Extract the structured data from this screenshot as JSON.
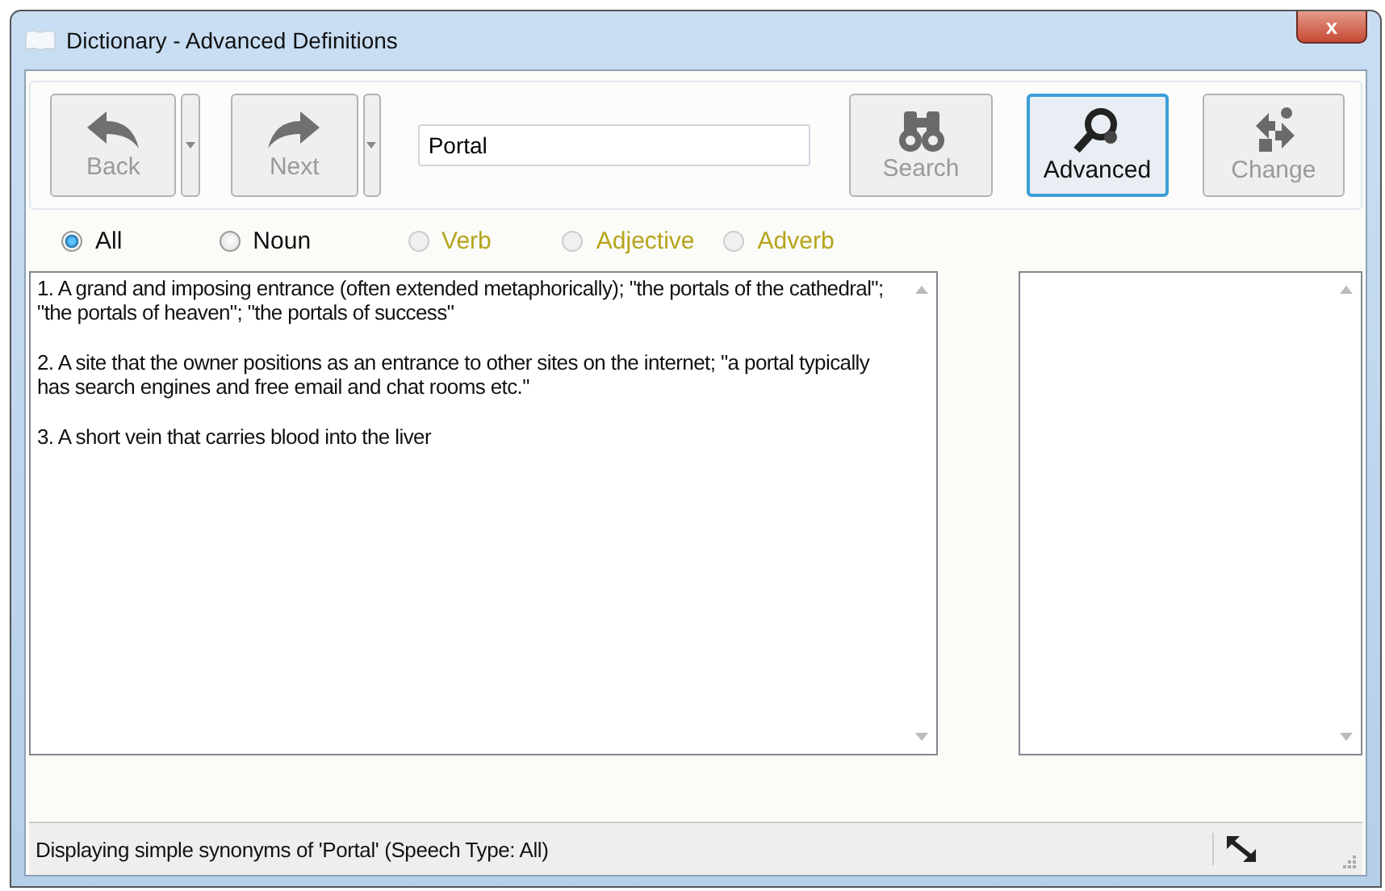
{
  "window": {
    "title": "Dictionary - Advanced Definitions",
    "close": "x"
  },
  "toolbar": {
    "nav_buttons": [
      {
        "label": "Back",
        "kind": "back",
        "disabled": true
      },
      {
        "label": "Next",
        "kind": "next",
        "disabled": true
      }
    ],
    "search": {
      "value": "Portal"
    },
    "action_buttons": [
      {
        "label": "Search",
        "kind": "search",
        "disabled": true,
        "selected": false
      },
      {
        "label": "Advanced",
        "kind": "advanced",
        "disabled": false,
        "selected": true
      },
      {
        "label": "Change",
        "kind": "change",
        "disabled": true,
        "selected": false
      }
    ]
  },
  "speech_types": [
    {
      "label": "All",
      "selected": true,
      "disabled": false
    },
    {
      "label": "Noun",
      "selected": false,
      "disabled": false
    },
    {
      "label": "Verb",
      "selected": false,
      "disabled": true
    },
    {
      "label": "Adjective",
      "selected": false,
      "disabled": true
    },
    {
      "label": "Adverb",
      "selected": false,
      "disabled": true
    }
  ],
  "definitions": [
    "1. A grand and imposing entrance (often extended metaphorically); \"the portals of the cathedral\"; \"the portals of heaven\"; \"the portals of success\"",
    "2. A site that the owner positions as an entrance to other sites on the internet; \"a portal typically has search engines and free email and chat rooms etc.\"",
    "3. A short vein that carries blood into the liver"
  ],
  "status_bar": {
    "text": "Displaying simple synonyms of 'Portal' (Speech Type: All)"
  }
}
